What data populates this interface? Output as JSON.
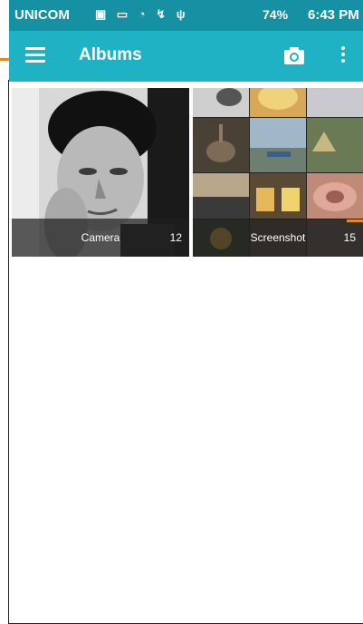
{
  "status_bar": {
    "carrier": "UNICOM",
    "icons_text": "▣ ▭ ◔ ↯ ψ",
    "battery": "74%",
    "time": "6:43 PM"
  },
  "app_bar": {
    "title": "Albums"
  },
  "albums": [
    {
      "name": "Camera",
      "count": "12"
    },
    {
      "name": "Screenshot",
      "count": "15"
    }
  ],
  "colors": {
    "status_bar": "#1591a3",
    "app_bar": "#1eb2c4",
    "marker": "#e58a24"
  }
}
